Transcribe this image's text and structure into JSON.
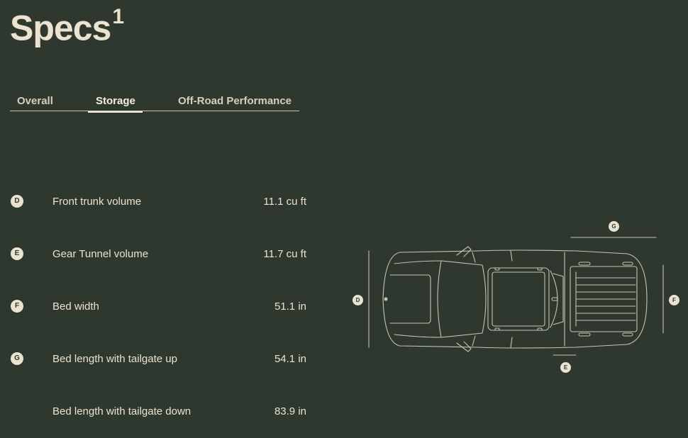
{
  "page": {
    "title": "Specs",
    "title_sup": "1"
  },
  "tabs": [
    {
      "label": "Overall",
      "active": false
    },
    {
      "label": "Storage",
      "active": true
    },
    {
      "label": "Off-Road Performance",
      "active": false
    }
  ],
  "specs": [
    {
      "badge": "D",
      "label": "Front trunk volume",
      "value": "11.1 cu ft"
    },
    {
      "badge": "E",
      "label": "Gear Tunnel volume",
      "value": "11.7 cu ft"
    },
    {
      "badge": "F",
      "label": "Bed width",
      "value": "51.1 in"
    },
    {
      "badge": "G",
      "label": "Bed length with tailgate up",
      "value": "54.1 in"
    },
    {
      "badge": "",
      "label": "Bed length with tailgate down",
      "value": "83.9 in"
    }
  ],
  "diagram": {
    "markers": {
      "d": "D",
      "e": "E",
      "f": "F",
      "g": "G"
    }
  },
  "colors": {
    "background": "#2f382e",
    "text": "#ebe3cf",
    "line": "#c9c3b0"
  }
}
